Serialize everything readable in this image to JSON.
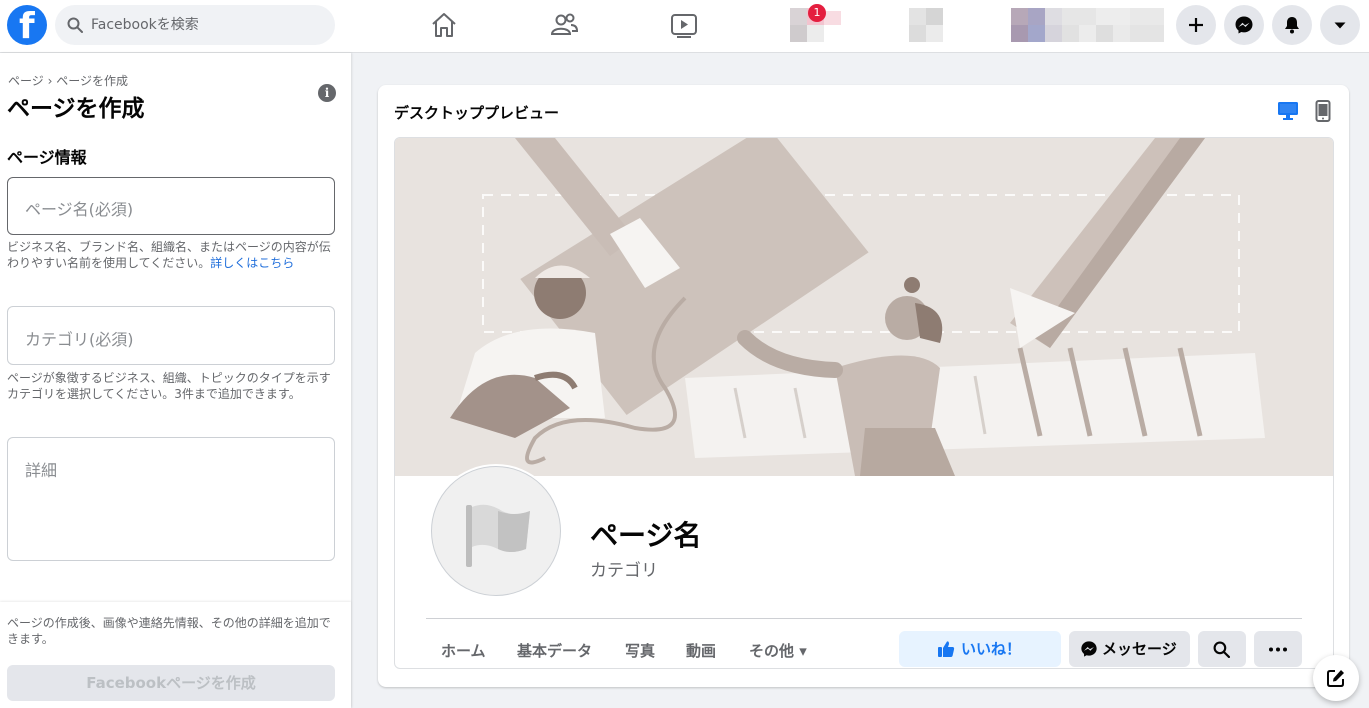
{
  "topbar": {
    "logo_letter": "f",
    "search_placeholder": "Facebookを検索",
    "notification_count": "1",
    "nav": [
      "home-icon",
      "friends-icon",
      "watch-icon"
    ],
    "actions": [
      "plus-icon",
      "messenger-icon",
      "bell-icon",
      "caret-down-icon"
    ]
  },
  "left": {
    "breadcrumb": "ページ › ページを作成",
    "title": "ページを作成",
    "info_icon": "i",
    "section_title": "ページ情報",
    "name_placeholder": "ページ名(必須)",
    "name_help": "ビジネス名、ブランド名、組織名、またはページの内容が伝わりやすい名前を使用してください。",
    "name_help_link": "詳しくはこちら",
    "category_placeholder": "カテゴリ(必須)",
    "category_help": "ページが象徴するビジネス、組織、トピックのタイプを示すカテゴリを選択してください。3件まで追加できます。",
    "details_placeholder": "詳細",
    "footer_text": "ページの作成後、画像や連絡先情報、その他の詳細を追加できます。",
    "create_button": "Facebookページを作成"
  },
  "preview": {
    "title": "デスクトッププレビュー",
    "page_name": "ページ名",
    "category": "カテゴリ",
    "tabs": [
      "ホーム",
      "基本データ",
      "写真",
      "動画",
      "その他 ▾"
    ],
    "like_button": "いいね！",
    "message_button": "メッセージ"
  },
  "colors": {
    "brand": "#1877f2",
    "background": "#f0f2f5",
    "notification": "#e41e3f"
  }
}
